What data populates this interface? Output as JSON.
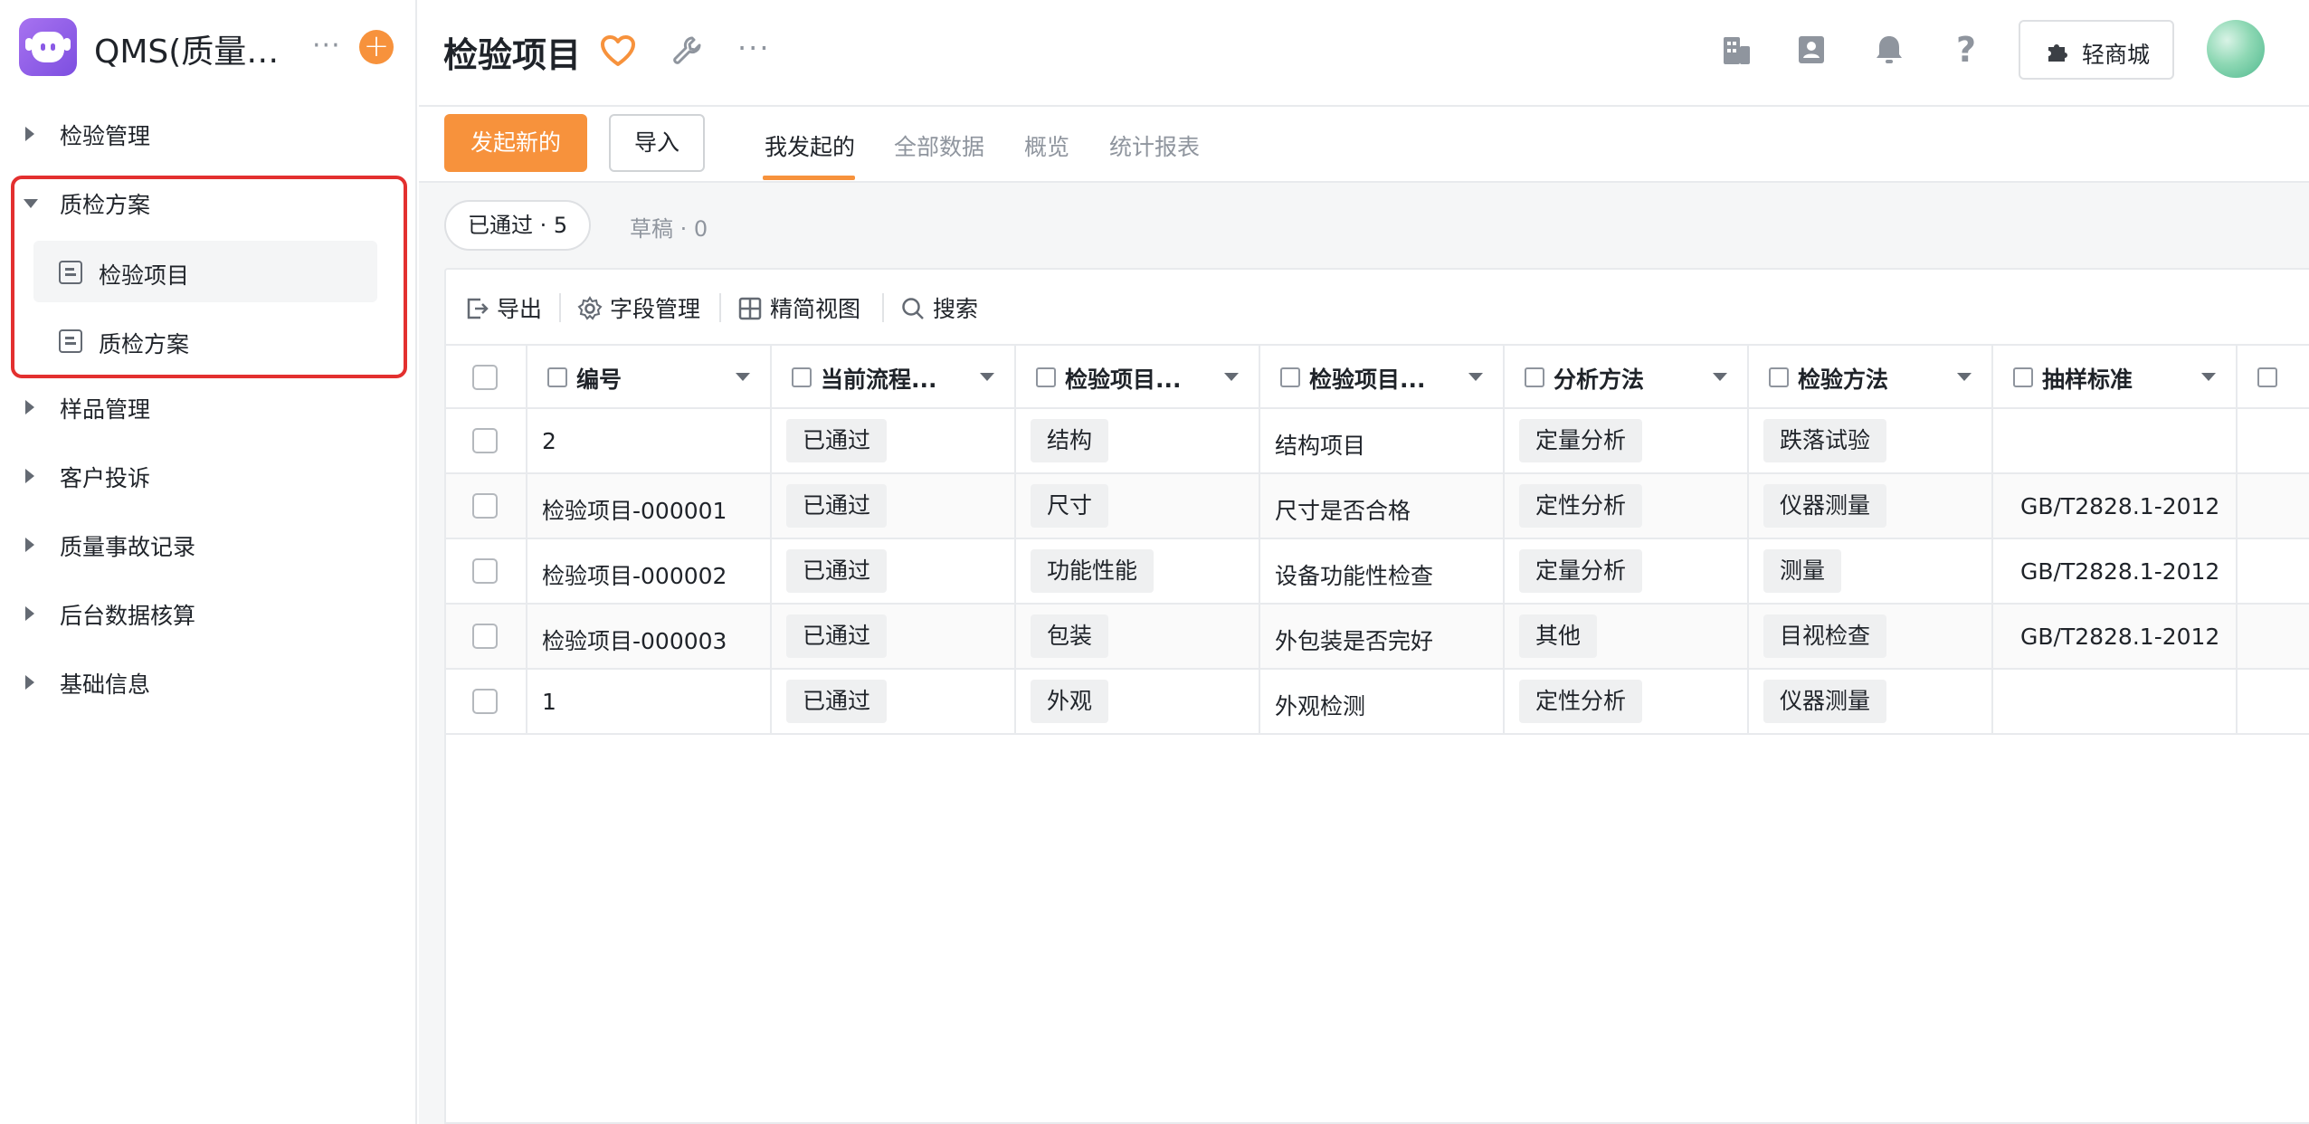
{
  "app": {
    "title": "QMS(质量管理系统)"
  },
  "sidebar": {
    "items": [
      {
        "label": "检验管理"
      },
      {
        "label": "质检方案"
      },
      {
        "label": "检验项目"
      },
      {
        "label": "质检方案"
      },
      {
        "label": "样品管理"
      },
      {
        "label": "客户投诉"
      },
      {
        "label": "质量事故记录"
      },
      {
        "label": "后台数据核算"
      },
      {
        "label": "基础信息"
      }
    ]
  },
  "header": {
    "title": "检验项目",
    "mall_label": "轻商城"
  },
  "actions": {
    "primary": "发起新的",
    "import": "导入"
  },
  "tabs": [
    "我发起的",
    "全部数据",
    "概览",
    "统计报表"
  ],
  "filters": {
    "passed": "已通过 · 5",
    "draft": "草稿 · 0"
  },
  "toolbar": {
    "export": "导出",
    "fields": "字段管理",
    "view": "精简视图",
    "search": "搜索"
  },
  "table": {
    "columns": [
      "编号",
      "当前流程...",
      "检验项目...",
      "检验项目...",
      "分析方法",
      "检验方法",
      "抽样标准"
    ],
    "rows": [
      {
        "id": "2",
        "status": "已通过",
        "category": "结构",
        "name": "结构项目",
        "analysis": "定量分析",
        "method": "跌落试验",
        "standard": ""
      },
      {
        "id": "检验项目-000001",
        "status": "已通过",
        "category": "尺寸",
        "name": "尺寸是否合格",
        "analysis": "定性分析",
        "method": "仪器测量",
        "standard": "GB/T2828.1-2012"
      },
      {
        "id": "检验项目-000002",
        "status": "已通过",
        "category": "功能性能",
        "name": "设备功能性检查",
        "analysis": "定量分析",
        "method": "测量",
        "standard": "GB/T2828.1-2012"
      },
      {
        "id": "检验项目-000003",
        "status": "已通过",
        "category": "包装",
        "name": "外包装是否完好",
        "analysis": "其他",
        "method": "目视检查",
        "standard": "GB/T2828.1-2012"
      },
      {
        "id": "1",
        "status": "已通过",
        "category": "外观",
        "name": "外观检测",
        "analysis": "定性分析",
        "method": "仪器测量",
        "standard": ""
      }
    ]
  },
  "colors": {
    "accent": "#f7923c",
    "highlight": "#e3302f"
  }
}
